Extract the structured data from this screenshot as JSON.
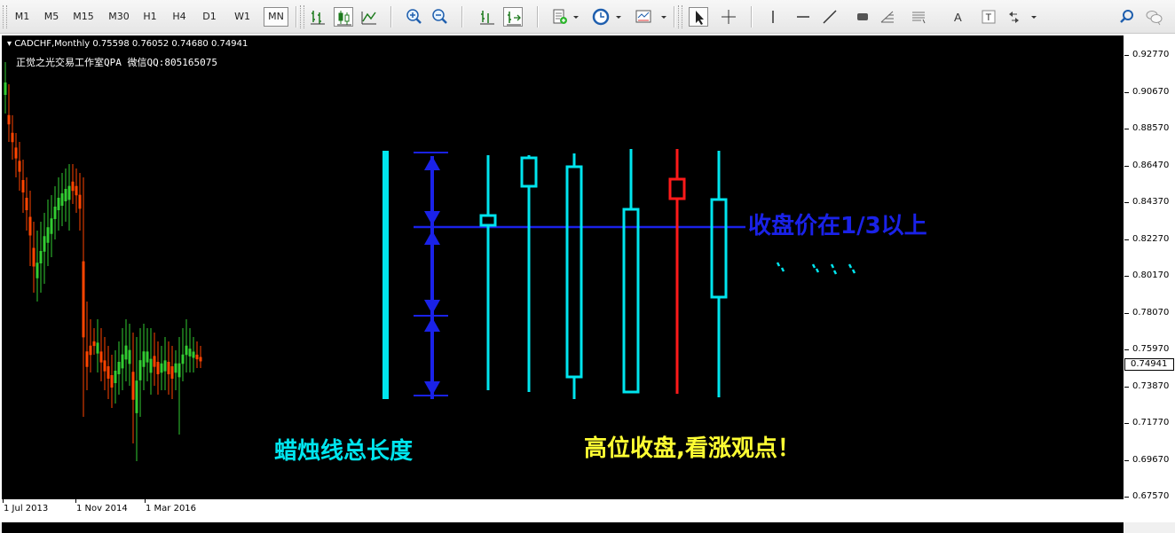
{
  "toolbar": {
    "timeframes": [
      "M1",
      "M5",
      "M15",
      "M30",
      "H1",
      "H4",
      "D1",
      "W1",
      "MN"
    ],
    "active_timeframe": "MN",
    "icons": [
      "bar-chart-icon",
      "candlestick-icon",
      "line-chart-icon",
      "zoom-in-icon",
      "zoom-out-icon",
      "chart-shift-icon",
      "autoscroll-icon",
      "new-order-icon",
      "periods-clock-icon",
      "templates-icon",
      "cursor-icon",
      "crosshair-icon",
      "vertical-line-icon",
      "horizontal-line-icon",
      "trendline-icon",
      "rectangle-icon",
      "fibonacci-icon",
      "channel-icon",
      "text-icon",
      "text-label-icon",
      "arrows-icon",
      "search-icon",
      "chat-icon"
    ]
  },
  "chart": {
    "info": "▾ CADCHF,Monthly  0.75598 0.76052 0.74680 0.74941",
    "watermark": "正觉之光交易工作室QPA 微信QQ:805165075",
    "background": "#000000",
    "bull_color": "#32cd32",
    "bear_color": "#ff4500",
    "current_price": "0.74941",
    "annotations": {
      "total_length": "蜡烛线总长度",
      "close_above": "收盘价在1/3以上",
      "high_close": "高位收盘,看涨观点！",
      "cyan_color": "#00e5ee",
      "blue_color": "#1a22e8",
      "yellow_color": "#ffff33",
      "red_color": "#ff1a1a"
    }
  },
  "price_axis": {
    "labels": [
      "0.92770",
      "0.90670",
      "0.88570",
      "0.86470",
      "0.84370",
      "0.82270",
      "0.80170",
      "0.78070",
      "0.75970",
      "0.73870",
      "0.71770",
      "0.69670",
      "0.67570"
    ]
  },
  "time_axis": {
    "labels": [
      "1 Jul 2013",
      "1 Nov 2014",
      "1 Mar 2016"
    ]
  }
}
